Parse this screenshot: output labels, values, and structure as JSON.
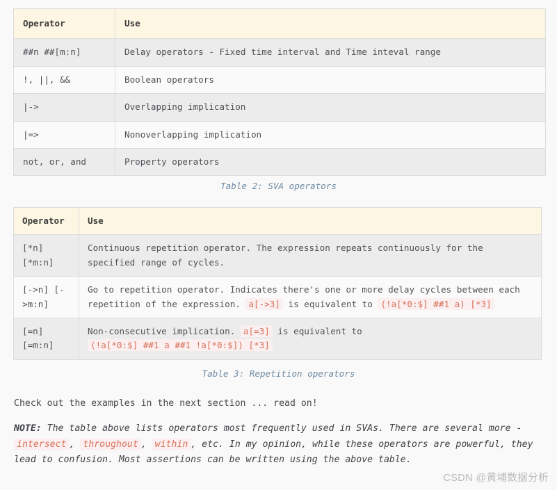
{
  "tables": [
    {
      "id": "sva-operators",
      "columns": [
        "Operator",
        "Use"
      ],
      "rows": [
        {
          "operator": "##n ##[m:n]",
          "use_parts": [
            {
              "type": "text",
              "text": "Delay operators - Fixed time interval and Time inteval range"
            }
          ]
        },
        {
          "operator": "!, ||, &&",
          "use_parts": [
            {
              "type": "text",
              "text": "Boolean operators"
            }
          ]
        },
        {
          "operator": "|->",
          "use_parts": [
            {
              "type": "text",
              "text": "Overlapping implication"
            }
          ]
        },
        {
          "operator": "|=>",
          "use_parts": [
            {
              "type": "text",
              "text": "Nonoverlapping implication"
            }
          ]
        },
        {
          "operator": "not, or, and",
          "use_parts": [
            {
              "type": "text",
              "text": "Property operators"
            }
          ]
        }
      ],
      "caption": "Table 2: SVA operators"
    },
    {
      "id": "repetition-operators",
      "columns": [
        "Operator",
        "Use"
      ],
      "rows": [
        {
          "operator": "[*n] [*m:n]",
          "use_parts": [
            {
              "type": "text",
              "text": "Continuous repetition operator. The expression repeats continuously for the specified range of cycles."
            }
          ]
        },
        {
          "operator": "[->n] [->m:n]",
          "use_parts": [
            {
              "type": "text",
              "text": "Go to repetition operator. Indicates there's one or more delay cycles between each repetition of the expression. "
            },
            {
              "type": "code",
              "text": "a[->3]"
            },
            {
              "type": "text",
              "text": " is equivalent to "
            },
            {
              "type": "code",
              "text": "(!a[*0:$] ##1 a) [*3]"
            }
          ]
        },
        {
          "operator": "[=n] [=m:n]",
          "use_parts": [
            {
              "type": "text",
              "text": "Non-consecutive implication. "
            },
            {
              "type": "code",
              "text": "a[=3]"
            },
            {
              "type": "text",
              "text": " is equivalent to "
            },
            {
              "type": "code",
              "text": "(!a[*0:$] ##1 a ##1 !a[*0:$]) [*3]"
            }
          ]
        }
      ],
      "caption": "Table 3: Repetition operators"
    }
  ],
  "paragraphs": {
    "check_out": "Check out the examples in the next section ... read on!",
    "note": {
      "label": "NOTE:",
      "parts": [
        {
          "type": "text",
          "text": " The table above lists operators most frequently used in SVAs. There are several more - "
        },
        {
          "type": "code",
          "text": "intersect"
        },
        {
          "type": "text",
          "text": ", "
        },
        {
          "type": "code",
          "text": "throughout"
        },
        {
          "type": "text",
          "text": ", "
        },
        {
          "type": "code",
          "text": "within"
        },
        {
          "type": "text",
          "text": ", etc. In my opinion, while these operators are powerful, they lead to confusion. Most assertions can be written using the above table."
        }
      ]
    }
  },
  "watermark": "CSDN @黄埔数据分析",
  "colors": {
    "page_background": "#f9f9f9",
    "table_header_background": "#fdf6e3",
    "row_odd_background": "#ececec",
    "row_even_background": "#fafafa",
    "border": "#dcdcdc",
    "code_text": "#d9725a",
    "code_background": "#fbeff0",
    "caption_text": "#6f8ba4",
    "body_text": "#45484c",
    "watermark_text": "#b9b9b9"
  }
}
